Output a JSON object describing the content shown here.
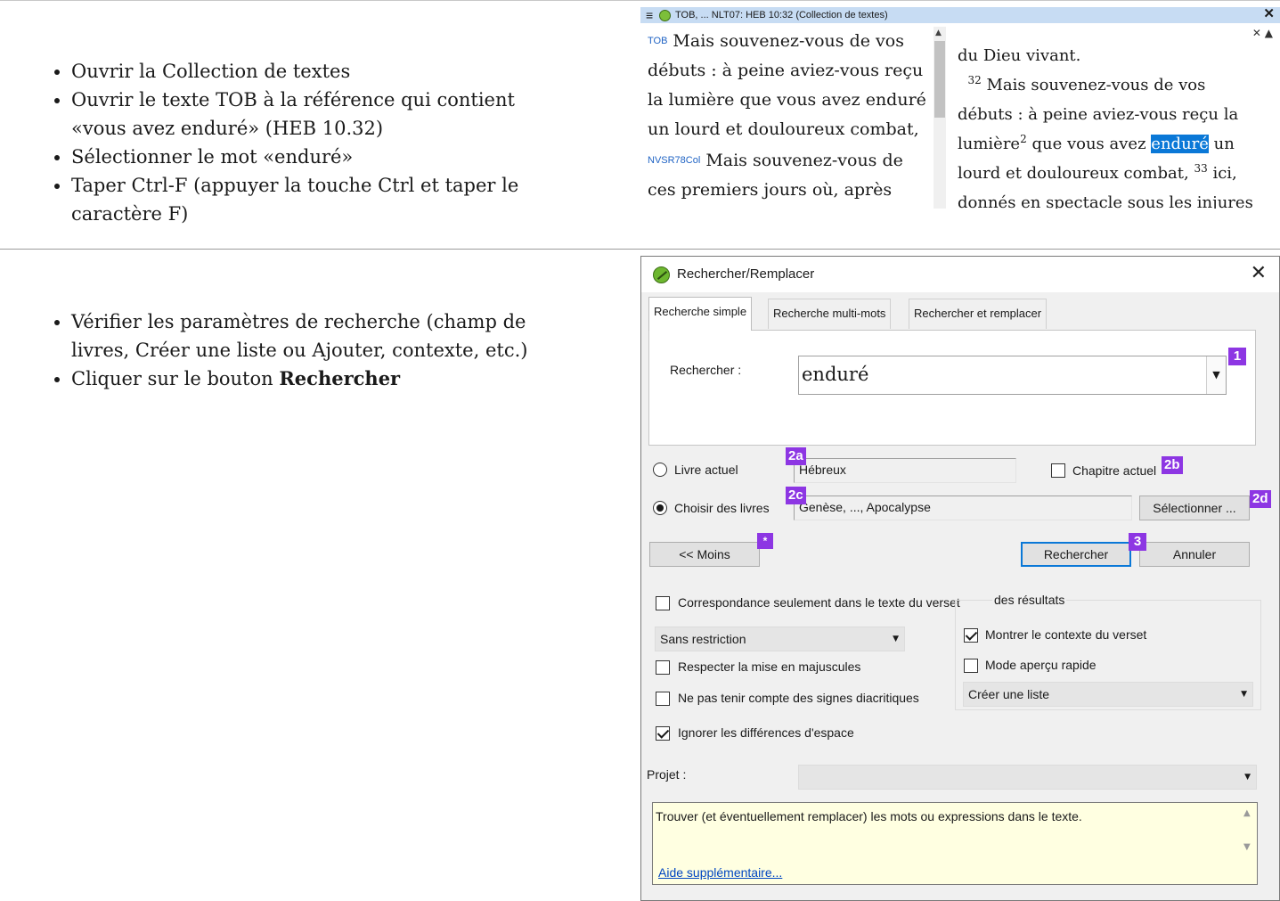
{
  "step1": {
    "instructions": [
      "Ouvrir la Collection de textes",
      "Ouvrir le texte TOB à la référence qui contient «vous avez enduré» (HEB 10.32)",
      "Sélectionner le mot «enduré»",
      "Taper Ctrl-F (appuyer la touche Ctrl et taper le caractère F)"
    ]
  },
  "collection": {
    "title": "TOB, ... NLT07: HEB 10:32 (Collection de textes)",
    "left_pane": {
      "v1_label": "TOB",
      "v1_text": "Mais souvenez-vous de vos débuts : à peine aviez-vous reçu la lumière que vous avez enduré un lourd et douloureux combat,",
      "v2_label": "NVSR78Col",
      "v2_text": "Mais souvenez-vous de ces premiers jours où, après avoir été"
    },
    "right_pane": {
      "line0": "du Dieu vivant.",
      "verse32_num": "32",
      "text_a": "Mais souvenez-vous de vos débuts : à peine aviez-vous reçu la lumière",
      "footnote": "2",
      "text_b": "que vous avez",
      "highlight": "enduré",
      "text_c": "un lourd et douloureux combat,",
      "verse33_num": "33",
      "text_d": "ici, donnés en spectacle sous les injures et"
    }
  },
  "step2": {
    "instr_1": "Vérifier les paramètres de recherche (champ de livres, Créer une liste ou Ajouter, contexte, etc.)",
    "instr_2_prefix": "Cliquer sur le bouton ",
    "instr_2_bold": "Rechercher"
  },
  "dialog": {
    "title": "Rechercher/Remplacer",
    "tabs": [
      "Recherche simple",
      "Recherche multi-mots",
      "Rechercher et remplacer"
    ],
    "search_label": "Rechercher :",
    "search_value": "enduré",
    "current_book_label": "Livre actuel",
    "current_book_value": "Hébreux",
    "current_chapter_label": "Chapitre actuel",
    "choose_books_label": "Choisir des livres",
    "choose_books_value": "Genèse, ..., Apocalypse",
    "select_button": "Sélectionner ...",
    "less_button": "<< Moins",
    "search_button": "Rechercher",
    "cancel_button": "Annuler",
    "match_verse_only": "Correspondance seulement dans le texte du verset",
    "results_group_label": "des résultats",
    "restriction_value": "Sans restriction",
    "show_context": "Montrer le contexte du verset",
    "case_sensitive": "Respecter la mise en majuscules",
    "quick_preview": "Mode aperçu rapide",
    "ignore_diacritics": "Ne pas tenir compte des signes diacritiques",
    "list_mode_value": "Créer une liste",
    "ignore_spaces": "Ignorer les différences d'espace",
    "project_label": "Projet :",
    "info_text": "Trouver (et éventuellement remplacer) les mots ou expressions dans le texte.",
    "help_link": "Aide supplémentaire...",
    "badges": {
      "b1": "1",
      "b2a": "2a",
      "b2b": "2b",
      "b2c": "2c",
      "b2d": "2d",
      "b3": "3",
      "bstar": "*"
    }
  }
}
